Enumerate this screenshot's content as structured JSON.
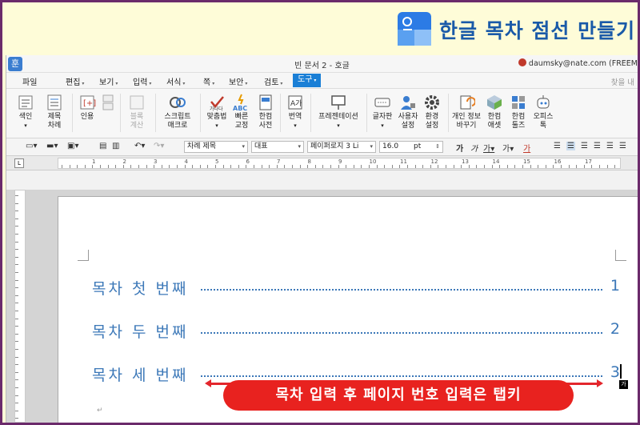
{
  "banner": {
    "title": "한글 목차 점선 만들기"
  },
  "window": {
    "app_icon": "훈",
    "title": "빈 문서 2 - 호글",
    "user": "daumsky@nate.com (FREEM"
  },
  "menu": {
    "items": [
      "파일",
      "편집",
      "보기",
      "입력",
      "서식",
      "쪽",
      "보안",
      "검토",
      "도구"
    ],
    "active": "도구",
    "search": "찾을 내"
  },
  "ribbon": {
    "buttons": [
      {
        "label": "색인",
        "sub": "",
        "icon": "index-icon"
      },
      {
        "label": "제목",
        "sub": "차례",
        "icon": "toc-icon"
      },
      {
        "label": "인용",
        "sub": "",
        "icon": "quote-icon"
      },
      {
        "label": "블록",
        "sub": "계산",
        "icon": "block-calc-icon"
      },
      {
        "label": "스크립트",
        "sub": "매크로",
        "icon": "script-macro-icon"
      },
      {
        "label": "맞춤법",
        "sub": "",
        "icon": "spellcheck-icon"
      },
      {
        "label": "빠른",
        "sub": "교정",
        "icon": "quick-correct-icon"
      },
      {
        "label": "한컴",
        "sub": "사전",
        "icon": "dictionary-icon"
      },
      {
        "label": "번역",
        "sub": "",
        "icon": "translate-icon"
      },
      {
        "label": "프레젠테이션",
        "sub": "",
        "icon": "presentation-icon"
      },
      {
        "label": "글자판",
        "sub": "",
        "icon": "keyboard-icon"
      },
      {
        "label": "사용자",
        "sub": "설정",
        "icon": "user-settings-icon"
      },
      {
        "label": "환경",
        "sub": "설정",
        "icon": "gear-icon"
      },
      {
        "label": "개인 정보",
        "sub": "바꾸기",
        "icon": "privacy-icon"
      },
      {
        "label": "한컴",
        "sub": "애셋",
        "icon": "asset-icon"
      },
      {
        "label": "한컴",
        "sub": "툴즈",
        "icon": "tools-icon"
      },
      {
        "label": "오피스",
        "sub": "톡",
        "icon": "office-talk-icon"
      }
    ]
  },
  "format": {
    "style": "차례 제목",
    "lang": "대표",
    "font": "페이퍼로지 3 Li",
    "size": "16.0",
    "unit": "pt",
    "font_color_char": "가"
  },
  "ruler": {
    "numbers": [
      "1",
      "2",
      "3",
      "4",
      "5",
      "6",
      "7",
      "8",
      "9",
      "10",
      "11",
      "12",
      "13",
      "14",
      "15",
      "16",
      "17"
    ]
  },
  "document": {
    "toc": [
      {
        "label": "목차 첫 번째",
        "page": "1"
      },
      {
        "label": "목차 두 번째",
        "page": "2"
      },
      {
        "label": "목차 세 번째",
        "page": "3"
      }
    ],
    "input_badge": "가"
  },
  "callout": {
    "text": "목차 입력 후 페이지 번호 입력은 탭키"
  },
  "colors": {
    "toc": "#3c78b8",
    "callout": "#e8221f",
    "active_menu": "#1a7fd6"
  }
}
